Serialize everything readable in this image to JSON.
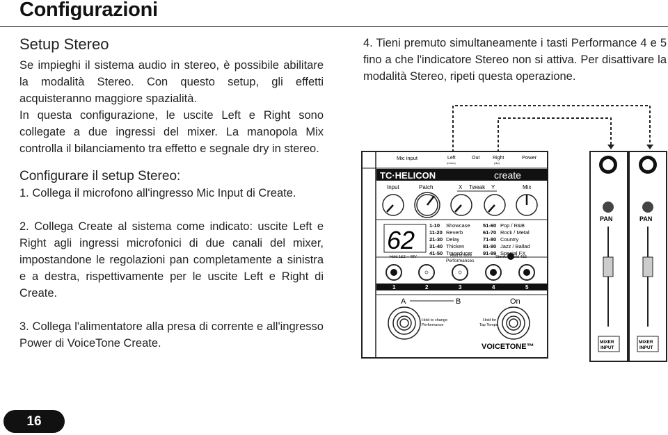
{
  "page_title": "Configurazioni",
  "section_title": "Setup Stereo",
  "intro_paragraphs": [
    "Se impieghi il sistema audio in stereo, è possibile abilitare la modalità Stereo. Con questo setup, gli effetti acquisteranno maggiore spazialità.",
    "In questa configurazione, le uscite Left e Right sono collegate a due ingressi del mixer. La manopola Mix controlla il bilanciamento tra effetto e segnale dry in stereo."
  ],
  "subsection_title": "Configurare il setup Stereo:",
  "steps": [
    "1. Collega il microfono all'ingresso Mic Input di Create.",
    "2. Collega Create al sistema come indicato: uscite Left e Right agli ingressi microfonici di due canali del mixer, impostandone le regolazioni pan completamente a sinistra e a destra, rispettivamente per le uscite Left e Right di Create.",
    "3. Collega l'alimentatore alla presa di corrente e all'ingresso Power di VoiceTone Create.",
    "4. Tieni premuto simultaneamente i tasti Performance 4 e 5 fino a che l'indicatore Stereo non si attiva. Per disattivare la modalità Stereo, ripeti questa operazione."
  ],
  "page_number": "16",
  "device": {
    "top_labels": [
      "Mic input",
      "Left",
      "(mono)",
      "Out",
      "Right",
      "(dry)",
      "Power"
    ],
    "brand": "TC·HELICON",
    "model": "create",
    "knob_labels": [
      "Input",
      "Patch",
      "X",
      "Tweak",
      "Y",
      "Mix"
    ],
    "display": "62",
    "presets_left": [
      [
        "1-10",
        "Showcase"
      ],
      [
        "11-20",
        "Reverb"
      ],
      [
        "21-30",
        "Delay"
      ],
      [
        "31-40",
        "Thicken"
      ],
      [
        "41-50",
        "Transducer"
      ]
    ],
    "presets_right": [
      [
        "51-60",
        "Pop / R&B"
      ],
      [
        "61-70",
        "Rock / Metal"
      ],
      [
        "71-80",
        "Country"
      ],
      [
        "81-90",
        "Jazz / Ballad"
      ],
      [
        "91-99",
        "Special FX"
      ]
    ],
    "hold_48v": "Hold 1&2 ○ 48V",
    "hold_store": "Hold to store",
    "performances": "Performances",
    "stereo_hold": "Stereo ● Hold 4&5",
    "buttons": [
      "1",
      "2",
      "3",
      "4",
      "5"
    ],
    "ab": [
      "A",
      "B"
    ],
    "on": "On",
    "hold_change": [
      "Hold to change",
      "Performance"
    ],
    "hold_tap": [
      "Hold for",
      "Tap Tempo"
    ],
    "logo": "VOICETONE™"
  },
  "mixer": {
    "pan": "PAN",
    "input": [
      "MIXER",
      "INPUT"
    ]
  }
}
